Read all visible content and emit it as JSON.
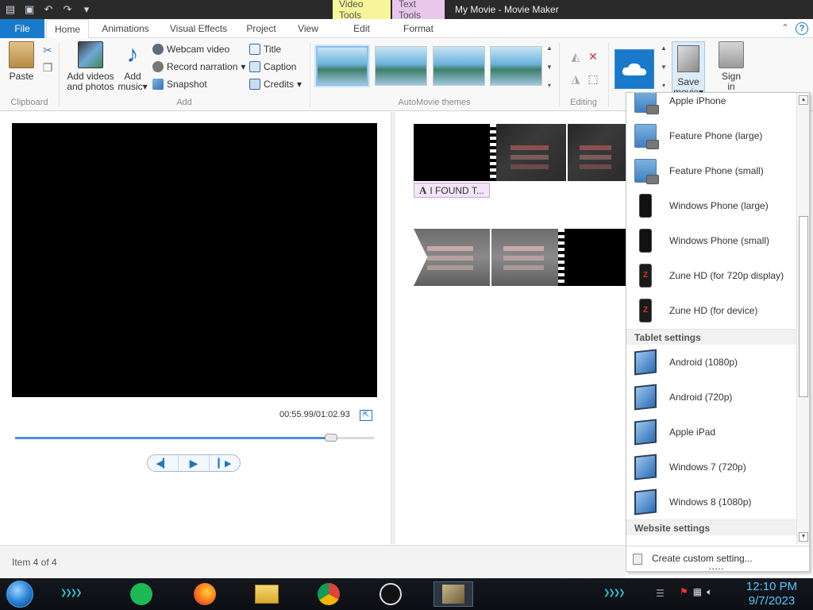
{
  "app": {
    "window_title": "My Movie - Movie Maker",
    "context_tabs": {
      "video_tools": "Video Tools",
      "text_tools": "Text Tools"
    }
  },
  "tabs": [
    {
      "label": "File"
    },
    {
      "label": "Home"
    },
    {
      "label": "Animations"
    },
    {
      "label": "Visual Effects"
    },
    {
      "label": "Project"
    },
    {
      "label": "View"
    },
    {
      "label": "Edit"
    },
    {
      "label": "Format"
    }
  ],
  "ribbon": {
    "clipboard": {
      "group": "Clipboard",
      "paste": "Paste"
    },
    "add": {
      "group": "Add",
      "add_videos_line1": "Add videos",
      "add_videos_line2": "and photos",
      "add_music_line1": "Add",
      "add_music_line2": "music",
      "webcam": "Webcam video",
      "narration": "Record narration",
      "snapshot": "Snapshot",
      "title": "Title",
      "caption": "Caption",
      "credits": "Credits"
    },
    "themes_group": "AutoMovie themes",
    "editing_group": "Editing",
    "save_movie_line1": "Save",
    "save_movie_line2": "movie",
    "sign_in_line1": "Sign",
    "sign_in_line2": "in"
  },
  "preview": {
    "time": "00:55.99/01:02.93",
    "progress": 0.88
  },
  "storyboard": {
    "caption_text": "I FOUND T..."
  },
  "menu": {
    "phone_items": [
      "Apple iPhone",
      "Feature Phone (large)",
      "Feature Phone (small)",
      "Windows Phone (large)",
      "Windows Phone (small)",
      "Zune HD (for 720p display)",
      "Zune HD (for device)"
    ],
    "tablet_section": "Tablet settings",
    "tablet_items": [
      "Android (1080p)",
      "Android (720p)",
      "Apple iPad",
      "Windows 7 (720p)",
      "Windows 8 (1080p)"
    ],
    "website_section": "Website settings",
    "custom_setting": "Create custom setting..."
  },
  "status": {
    "item_text": "Item 4 of 4"
  },
  "taskbar": {
    "time": "12:10 PM",
    "date": "9/7/2023"
  },
  "colors": {
    "file_tab": "#1979ca",
    "video_tools": "#f6f59a",
    "text_tools": "#e9c7ec",
    "clock": "#58c6ff"
  }
}
